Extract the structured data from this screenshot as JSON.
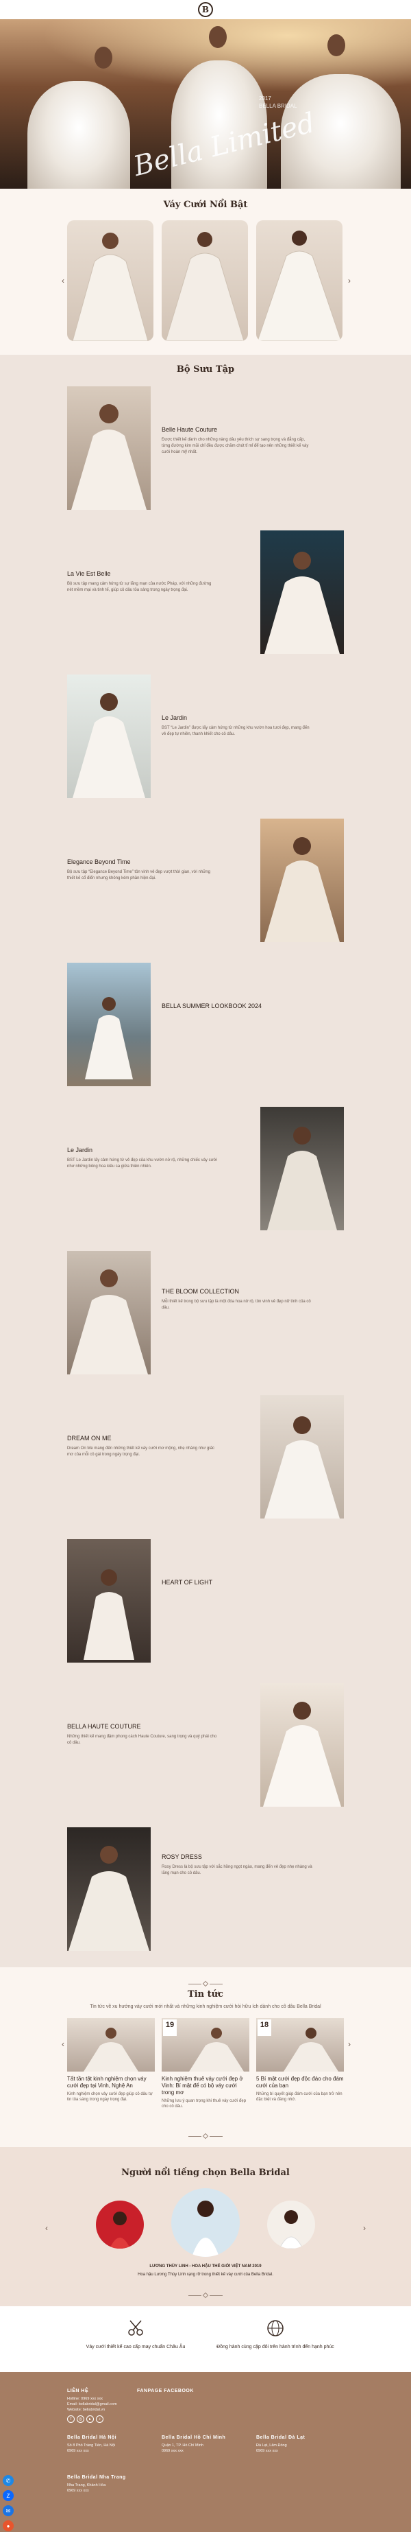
{
  "header": {
    "logo_letter": "B"
  },
  "hero": {
    "script": "Bella Limited",
    "tag_line_1": "2017",
    "tag_line_2": "BELLA BRIDAL"
  },
  "featured": {
    "title": "Váy Cưới Nổi Bật",
    "prev_icon": "chevron-left-icon",
    "next_icon": "chevron-right-icon"
  },
  "collections": {
    "title": "Bộ Sưu Tập",
    "items": [
      {
        "title": "Belle Haute Couture",
        "desc": "Được thiết kế dành cho những nàng dâu yêu thích sự sang trọng và đẳng cấp, từng đường kim mũi chỉ đều được chăm chút tỉ mỉ để tạo nên những thiết kế váy cưới hoàn mỹ nhất."
      },
      {
        "title": "La Vie Est Belle",
        "desc": "Bộ sưu tập mang cảm hứng từ sự lãng mạn của nước Pháp, với những đường nét mềm mại và tinh tế, giúp cô dâu tỏa sáng trong ngày trọng đại."
      },
      {
        "title": "Le Jardin",
        "desc": "BST “Le Jardin” được lấy cảm hứng từ những khu vườn hoa tươi đẹp, mang đến vẻ đẹp tự nhiên, thanh khiết cho cô dâu."
      },
      {
        "title": "Elegance Beyond Time",
        "desc": "Bộ sưu tập “Elegance Beyond Time” tôn vinh vẻ đẹp vượt thời gian, với những thiết kế cổ điển nhưng không kém phần hiện đại."
      },
      {
        "title": "BELLA SUMMER LOOKBOOK 2024",
        "desc": ""
      },
      {
        "title": "Le Jardin",
        "desc": "BST Le Jardin lấy cảm hứng từ vẻ đẹp của khu vườn nở rộ, những chiếc váy cưới như những bông hoa kiêu sa giữa thiên nhiên."
      },
      {
        "title": "THE BLOOM COLLECTION",
        "desc": "Mỗi thiết kế trong bộ sưu tập là một đóa hoa nở rộ, tôn vinh vẻ đẹp nữ tính của cô dâu."
      },
      {
        "title": "DREAM ON ME",
        "desc": "Dream On Me mang đến những thiết kế váy cưới mơ mộng, nhẹ nhàng như giấc mơ của mỗi cô gái trong ngày trọng đại."
      },
      {
        "title": "HEART OF LIGHT",
        "desc": ""
      },
      {
        "title": "BELLA HAUTE COUTURE",
        "desc": "Những thiết kế mang đậm phong cách Haute Couture, sang trọng và quý phái cho cô dâu."
      },
      {
        "title": "ROSY DRESS",
        "desc": "Rosy Dress là bộ sưu tập với sắc hồng ngọt ngào, mang đến vẻ đẹp nhẹ nhàng và lãng mạn cho cô dâu."
      }
    ]
  },
  "news": {
    "title": "Tin tức",
    "subtitle": "Tin tức về xu hướng váy cưới mới nhất và những kinh nghiệm cưới hỏi hữu ích dành cho cô dâu Bella Bridal",
    "items": [
      {
        "day": "",
        "month": "",
        "title": "Tất tần tật kinh nghiệm chọn váy cưới đẹp tại Vinh, Nghệ An",
        "excerpt": "Kinh nghiệm chọn váy cưới đẹp giúp cô dâu tự tin tỏa sáng trong ngày trọng đại."
      },
      {
        "day": "19",
        "month": "",
        "title": "Kinh nghiệm thuê váy cưới đẹp ở Vinh: Bí mật để có bộ váy cưới trong mơ",
        "excerpt": "Những lưu ý quan trọng khi thuê váy cưới đẹp cho cô dâu."
      },
      {
        "day": "19",
        "month": "",
        "title": "Kinh nghiệm thuê váy cưới đẹp ở Vinh, Bí mật để có bộ váy cưới hoàn hảo",
        "excerpt": "Kinh nghiệm thuê váy cưới giúp cô dâu tiết kiệm chi phí."
      },
      {
        "day": "18",
        "month": "",
        "title": "5 Bí mật cưới đẹp độc đáo cho đám cưới của bạn",
        "excerpt": "Những bí quyết giúp đám cưới của bạn trở nên đặc biệt và đáng nhớ."
      }
    ]
  },
  "celebs": {
    "title": "Người nổi tiếng chọn Bella Bridal",
    "caption_title": "LƯƠNG THÙY LINH - HOA HẬU THẾ GIỚI VIỆT NAM 2019",
    "caption_desc": "Hoa hậu Lương Thùy Linh rạng rỡ trong thiết kế váy cưới của Bella Bridal."
  },
  "services": [
    {
      "icon": "scissors-icon",
      "label": "Váy cưới thiết kế cao cấp may chuẩn Châu Âu"
    },
    {
      "icon": "globe-icon",
      "label": "Đồng hành cùng cặp đôi trên hành trình đến hạnh phúc"
    }
  ],
  "footer": {
    "contact_head": "LIÊN HỆ",
    "contact_lines": [
      "Hotline: 0969 xxx xxx",
      "Email: bellabridal@gmail.com",
      "Website: bellabridal.vn"
    ],
    "fanpage_head": "FANPAGE FACEBOOK",
    "branches": [
      {
        "head": "Bella Bridal Hà Nội",
        "lines": [
          "Số 8 Phố Tràng Tiền, Hà Nội",
          "0969 xxx xxx"
        ]
      },
      {
        "head": "Bella Bridal Hồ Chí Minh",
        "lines": [
          "Quận 1, TP. Hồ Chí Minh",
          "0969 xxx xxx"
        ]
      },
      {
        "head": "Bella Bridal Đà Lạt",
        "lines": [
          "Đà Lạt, Lâm Đồng",
          "0969 xxx xxx"
        ]
      },
      {
        "head": "Bella Bridal Nha Trang",
        "lines": [
          "Nha Trang, Khánh Hòa",
          "0969 xxx xxx"
        ]
      }
    ]
  },
  "colors": {
    "accent": "#a57d63",
    "dark": "#3a2a22"
  }
}
